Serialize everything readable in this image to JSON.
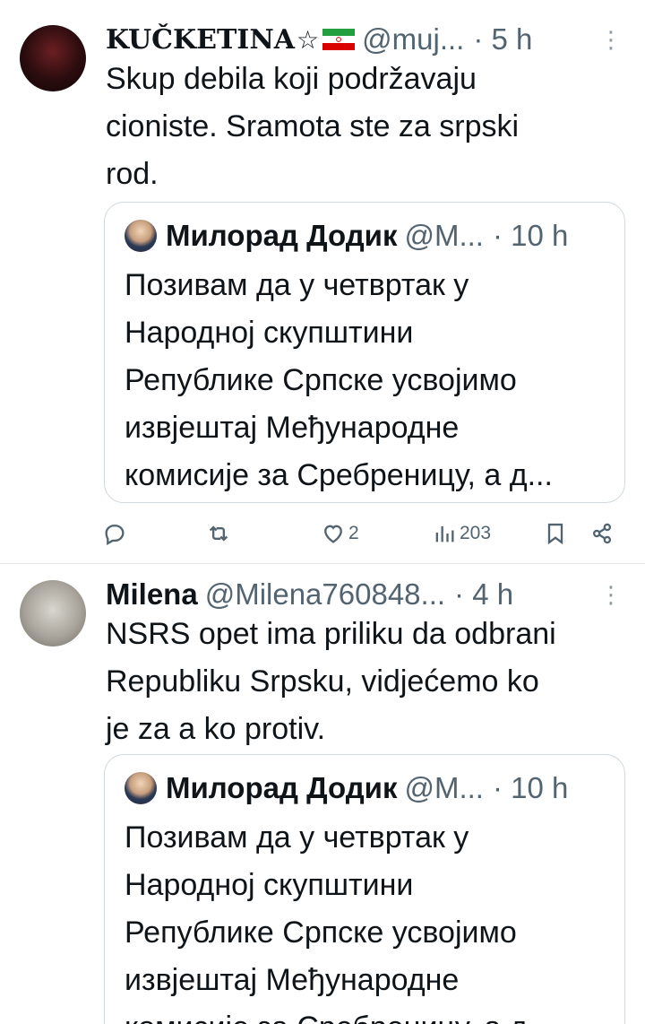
{
  "tweets": [
    {
      "author_name": "KUČKETINA",
      "author_symbol": "☆",
      "handle": "@muj...",
      "time": "· 5 h",
      "more": "⋮",
      "text": "Skup debila koji podržavaju\ncioniste. Sramota ste za srpski\nrod.",
      "quote": {
        "author_name": "Милорад Додик",
        "handle": "@M...",
        "time": "· 10 h",
        "text": "Позивам да у четвртак у\nНародној скупштини\nРепублике Српске усвојимо\nизвјештај Међународне\nкомисије за Сребреницу, а д..."
      },
      "actions": {
        "reply": "",
        "repost": "",
        "likes": "2",
        "views": "203"
      }
    },
    {
      "author_name": "Milena",
      "handle": "@Milena760848...",
      "time": "· 4 h",
      "more": "⋮",
      "text": "NSRS opet ima priliku da odbrani\nRepubliku Srpsku, vidjećemo ko\nje za a ko protiv.",
      "quote": {
        "author_name": "Милорад Додик",
        "handle": "@M...",
        "time": "· 10 h",
        "text": "Позивам да у четвртак у\nНародној скупштини\nРепублике Српске усвојимо\nизвјештај Међународне\nкомисије за Сребреницу, а д..."
      }
    }
  ],
  "colors": {
    "text": "#0f1419",
    "secondary": "#536471",
    "border": "#cfd9de",
    "iran_green": "#239f40",
    "iran_red": "#da0000"
  },
  "icons": {
    "reply": "reply-icon",
    "repost": "repost-icon",
    "like": "heart-icon",
    "views": "views-icon",
    "bookmark": "bookmark-icon",
    "share": "share-icon",
    "flag": "iran-flag-icon"
  }
}
